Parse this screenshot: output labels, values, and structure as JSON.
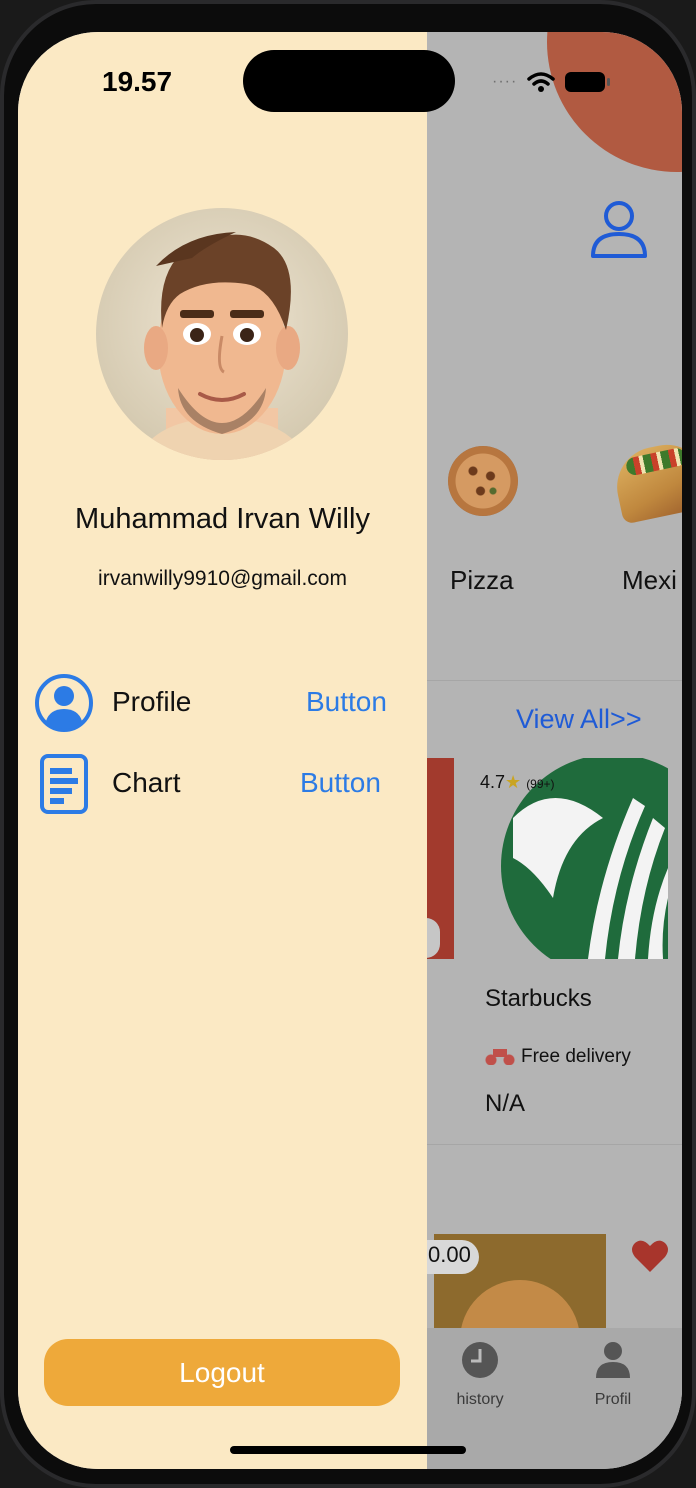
{
  "status_bar": {
    "time": "19.57",
    "signal_dots": "····"
  },
  "drawer": {
    "user_name": "Muhammad Irvan Willy",
    "user_email": "irvanwilly9910@gmail.com",
    "menu": [
      {
        "label": "Profile",
        "button_label": "Button",
        "icon": "user-circle-icon"
      },
      {
        "label": "Chart",
        "button_label": "Button",
        "icon": "document-chart-icon"
      }
    ],
    "logout_label": "Logout",
    "background_color": "#fbe9c4",
    "logout_color": "#eea93a",
    "accent_color": "#2c7be5"
  },
  "background_app": {
    "categories": [
      {
        "label": "Pizza"
      },
      {
        "label": "Mexi"
      }
    ],
    "view_all_label": "View All>>",
    "restaurant": {
      "rating": "4.7",
      "rating_count": "(99+)",
      "name": "Starbucks",
      "delivery": "Free delivery",
      "price": "N/A"
    },
    "food_price_fragment": "0.00",
    "tabs": [
      {
        "label": "history",
        "icon": "clock-icon"
      },
      {
        "label": "Profil",
        "icon": "person-icon"
      }
    ]
  }
}
